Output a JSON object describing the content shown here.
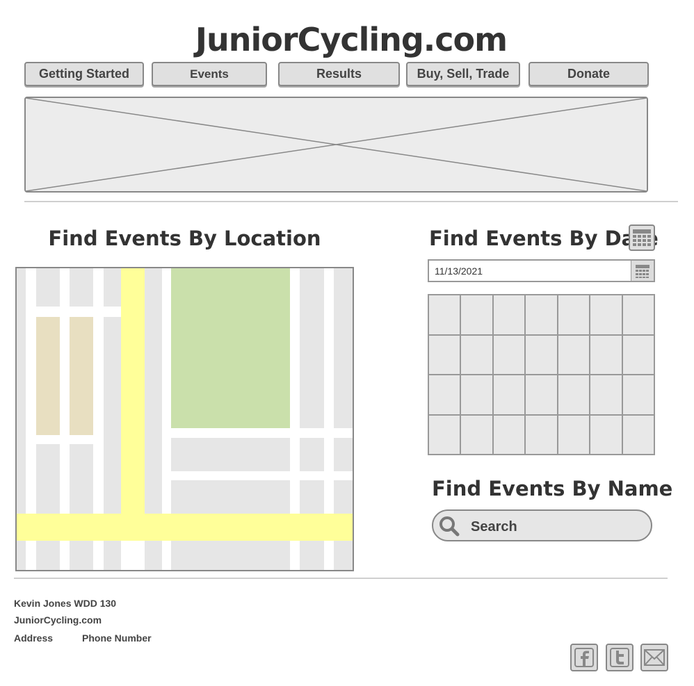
{
  "site": {
    "title": "JuniorCycling.com"
  },
  "nav": {
    "items": [
      {
        "label": "Getting Started"
      },
      {
        "label": "Events"
      },
      {
        "label": "Results"
      },
      {
        "label": "Buy, Sell, Trade"
      },
      {
        "label": "Donate"
      }
    ]
  },
  "sections": {
    "location_title": "Find Events By Location",
    "date_title": "Find Events By Date",
    "name_title": "Find Events By Name"
  },
  "date_picker": {
    "value": "11/13/2021"
  },
  "search": {
    "placeholder": "Search"
  },
  "footer": {
    "line1": "Kevin Jones WDD 130",
    "line2": "JuniorCycling.com",
    "address": "Address",
    "phone": "Phone Number"
  },
  "social": {
    "icons": [
      "facebook-icon",
      "twitter-icon",
      "email-icon"
    ]
  },
  "colors": {
    "map_road_major": "#ffff99",
    "map_park": "#cae0ab",
    "map_building_tan": "#e8dfc1",
    "map_block": "#e6e6e6"
  }
}
